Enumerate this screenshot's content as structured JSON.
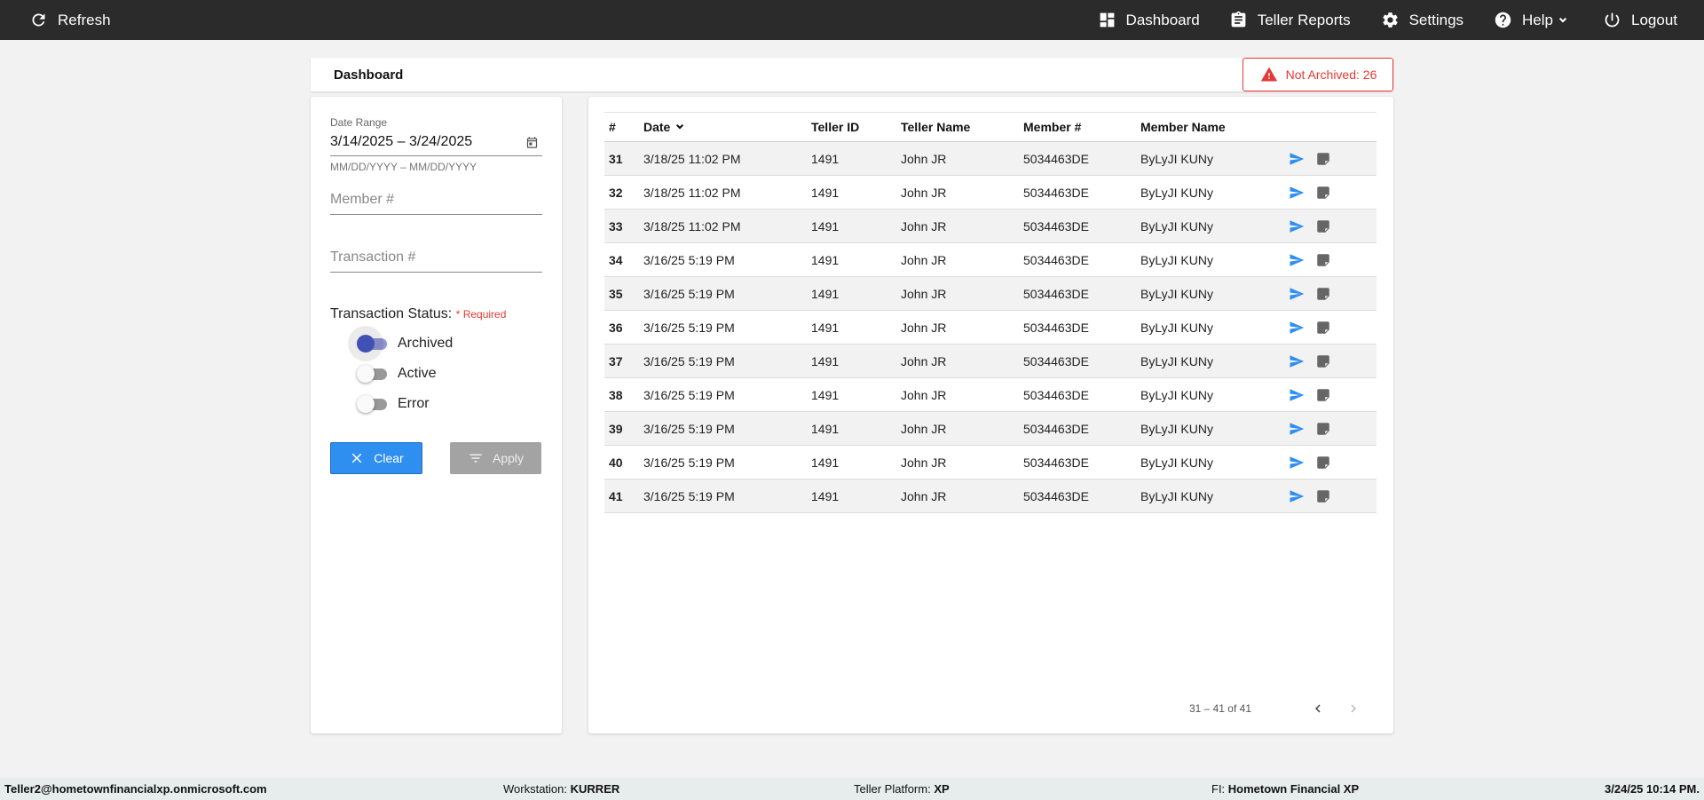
{
  "topbar": {
    "refresh_label": "Refresh",
    "nav": {
      "dashboard": "Dashboard",
      "teller_reports": "Teller Reports",
      "settings": "Settings",
      "help": "Help",
      "logout": "Logout"
    }
  },
  "header": {
    "title": "Dashboard",
    "not_archived": "Not Archived: 26"
  },
  "filters": {
    "date_range_label": "Date Range",
    "date_range_value": "3/14/2025 – 3/24/2025",
    "date_hint": "MM/DD/YYYY – MM/DD/YYYY",
    "member_placeholder": "Member #",
    "transaction_placeholder": "Transaction #",
    "status_title": "Transaction Status:",
    "required_label": "* Required",
    "statuses": [
      {
        "label": "Archived",
        "checked": true
      },
      {
        "label": "Active",
        "checked": false
      },
      {
        "label": "Error",
        "checked": false
      }
    ],
    "clear_label": "Clear",
    "apply_label": "Apply"
  },
  "table": {
    "columns": [
      "#",
      "Date",
      "Teller ID",
      "Teller Name",
      "Member #",
      "Member Name"
    ],
    "rows": [
      {
        "num": "31",
        "date": "3/18/25 11:02 PM",
        "teller_id": "1491",
        "teller_name": "John JR",
        "member": "5034463DE",
        "member_name": "ByLyJI KUNy"
      },
      {
        "num": "32",
        "date": "3/18/25 11:02 PM",
        "teller_id": "1491",
        "teller_name": "John JR",
        "member": "5034463DE",
        "member_name": "ByLyJI KUNy"
      },
      {
        "num": "33",
        "date": "3/18/25 11:02 PM",
        "teller_id": "1491",
        "teller_name": "John JR",
        "member": "5034463DE",
        "member_name": "ByLyJI KUNy"
      },
      {
        "num": "34",
        "date": "3/16/25 5:19 PM",
        "teller_id": "1491",
        "teller_name": "John JR",
        "member": "5034463DE",
        "member_name": "ByLyJI KUNy"
      },
      {
        "num": "35",
        "date": "3/16/25 5:19 PM",
        "teller_id": "1491",
        "teller_name": "John JR",
        "member": "5034463DE",
        "member_name": "ByLyJI KUNy"
      },
      {
        "num": "36",
        "date": "3/16/25 5:19 PM",
        "teller_id": "1491",
        "teller_name": "John JR",
        "member": "5034463DE",
        "member_name": "ByLyJI KUNy"
      },
      {
        "num": "37",
        "date": "3/16/25 5:19 PM",
        "teller_id": "1491",
        "teller_name": "John JR",
        "member": "5034463DE",
        "member_name": "ByLyJI KUNy"
      },
      {
        "num": "38",
        "date": "3/16/25 5:19 PM",
        "teller_id": "1491",
        "teller_name": "John JR",
        "member": "5034463DE",
        "member_name": "ByLyJI KUNy"
      },
      {
        "num": "39",
        "date": "3/16/25 5:19 PM",
        "teller_id": "1491",
        "teller_name": "John JR",
        "member": "5034463DE",
        "member_name": "ByLyJI KUNy"
      },
      {
        "num": "40",
        "date": "3/16/25 5:19 PM",
        "teller_id": "1491",
        "teller_name": "John JR",
        "member": "5034463DE",
        "member_name": "ByLyJI KUNy"
      },
      {
        "num": "41",
        "date": "3/16/25 5:19 PM",
        "teller_id": "1491",
        "teller_name": "John JR",
        "member": "5034463DE",
        "member_name": "ByLyJI KUNy"
      }
    ],
    "pagination": "31 – 41 of 41"
  },
  "footer": {
    "user": "Teller2@hometownfinancialxp.onmicrosoft.com",
    "workstation_label": "Workstation:",
    "workstation": "KURRER",
    "platform_label": "Teller Platform:",
    "platform": "XP",
    "fi_label": "FI:",
    "fi": "Hometown Financial XP",
    "datetime": "3/24/25 10:14 PM."
  },
  "colors": {
    "topbar": "#2b2b2b",
    "accent_blue": "#2f8ff0",
    "alert_red": "#e53935",
    "toggle_on": "#3f51b5"
  },
  "icons": {
    "refresh": "refresh-icon",
    "dashboard": "dashboard-icon",
    "reports": "clipboard-icon",
    "settings": "gear-icon",
    "help": "help-circle-icon",
    "logout": "power-icon",
    "warning": "warning-icon",
    "send": "send-icon",
    "note": "note-icon"
  }
}
